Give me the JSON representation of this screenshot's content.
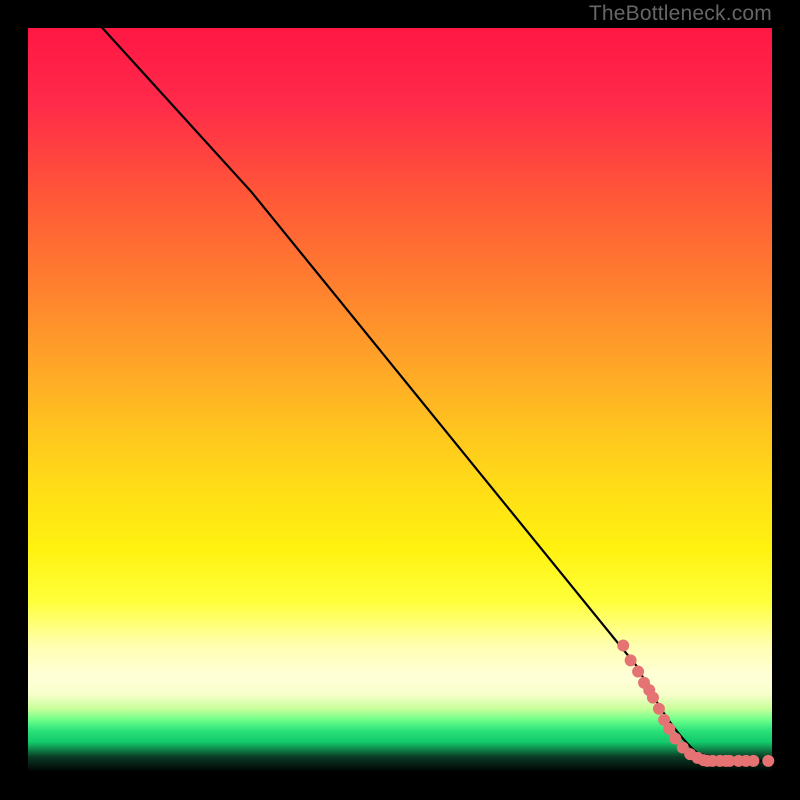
{
  "attribution": "TheBottleneck.com",
  "chart_data": {
    "type": "line",
    "title": "",
    "xlabel": "",
    "ylabel": "",
    "x_range": [
      0,
      100
    ],
    "y_range": [
      0,
      100
    ],
    "gradient_stops": [
      {
        "pct": 0,
        "color": "#ff1744"
      },
      {
        "pct": 10,
        "color": "#ff2a4a"
      },
      {
        "pct": 22,
        "color": "#ff5538"
      },
      {
        "pct": 33,
        "color": "#ff7a30"
      },
      {
        "pct": 45,
        "color": "#ffa428"
      },
      {
        "pct": 55,
        "color": "#ffc81e"
      },
      {
        "pct": 63,
        "color": "#ffe016"
      },
      {
        "pct": 70,
        "color": "#fff210"
      },
      {
        "pct": 77,
        "color": "#ffff3a"
      },
      {
        "pct": 83,
        "color": "#ffffb0"
      },
      {
        "pct": 89.5,
        "color": "#f8ffcc"
      },
      {
        "pct": 93,
        "color": "#6cff8a"
      },
      {
        "pct": 96,
        "color": "#12c96a"
      },
      {
        "pct": 100,
        "color": "#000000"
      }
    ],
    "series": [
      {
        "name": "curve",
        "color": "#000000",
        "points": [
          {
            "x": 10.0,
            "y": 100.0
          },
          {
            "x": 30.0,
            "y": 78.0
          },
          {
            "x": 82.0,
            "y": 14.0
          },
          {
            "x": 86.0,
            "y": 6.0
          },
          {
            "x": 90.0,
            "y": 2.5
          },
          {
            "x": 94.0,
            "y": 1.5
          },
          {
            "x": 100.0,
            "y": 1.5
          }
        ]
      }
    ],
    "scatter": {
      "name": "datapoints",
      "color": "#e57373",
      "radius": 6,
      "points": [
        {
          "x": 80.0,
          "y": 17.0
        },
        {
          "x": 81.0,
          "y": 15.0
        },
        {
          "x": 82.0,
          "y": 13.5
        },
        {
          "x": 82.8,
          "y": 12.0
        },
        {
          "x": 83.5,
          "y": 11.0
        },
        {
          "x": 84.0,
          "y": 10.0
        },
        {
          "x": 84.8,
          "y": 8.5
        },
        {
          "x": 85.5,
          "y": 7.0
        },
        {
          "x": 86.2,
          "y": 5.8
        },
        {
          "x": 87.0,
          "y": 4.5
        },
        {
          "x": 88.0,
          "y": 3.3
        },
        {
          "x": 89.0,
          "y": 2.4
        },
        {
          "x": 90.0,
          "y": 1.9
        },
        {
          "x": 90.8,
          "y": 1.6
        },
        {
          "x": 91.3,
          "y": 1.5
        },
        {
          "x": 92.0,
          "y": 1.5
        },
        {
          "x": 93.0,
          "y": 1.5
        },
        {
          "x": 93.8,
          "y": 1.5
        },
        {
          "x": 94.3,
          "y": 1.5
        },
        {
          "x": 95.5,
          "y": 1.5
        },
        {
          "x": 96.5,
          "y": 1.5
        },
        {
          "x": 97.5,
          "y": 1.5
        },
        {
          "x": 99.5,
          "y": 1.5
        }
      ]
    }
  }
}
